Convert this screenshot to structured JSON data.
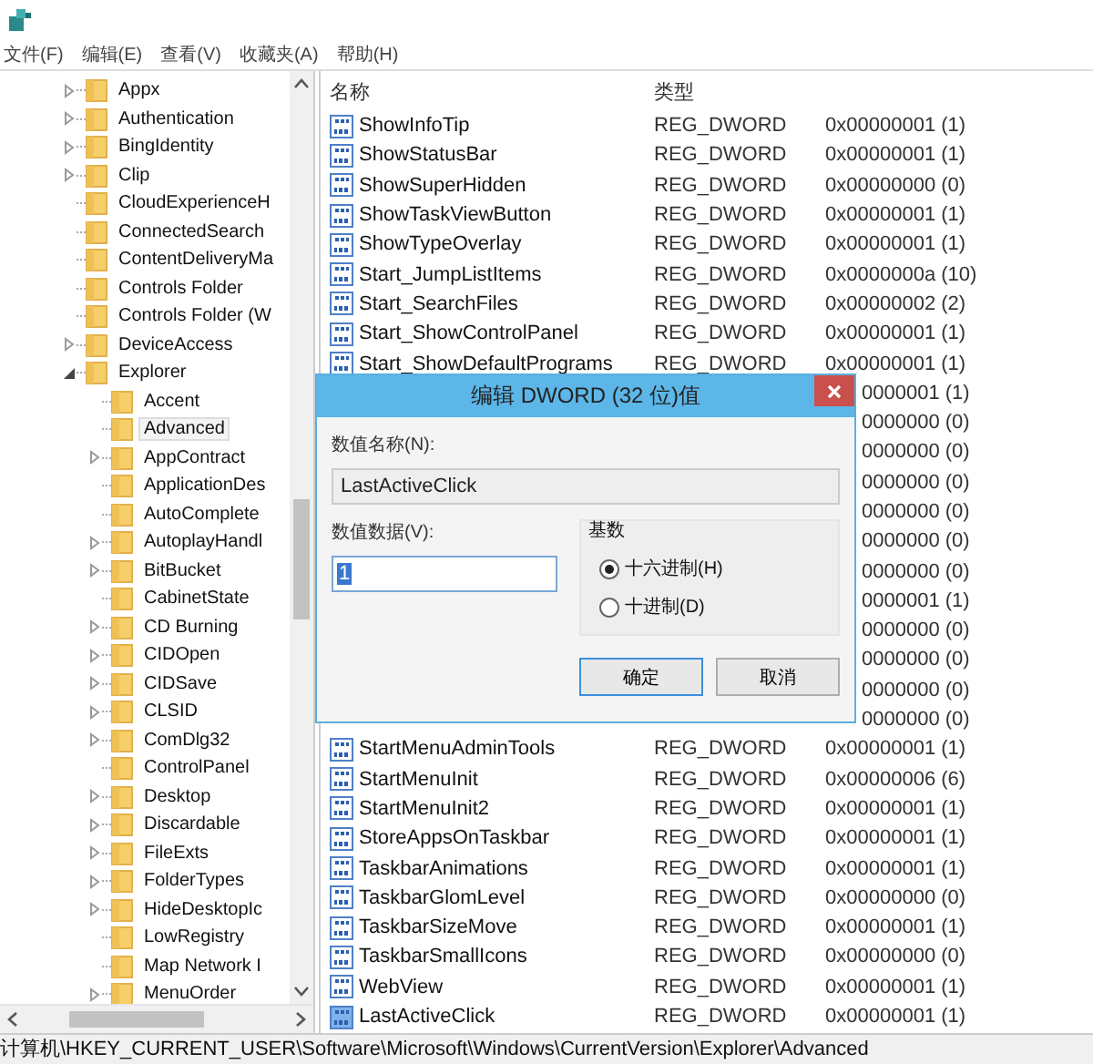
{
  "menu": [
    {
      "label": "文件(F)"
    },
    {
      "label": "编辑(E)"
    },
    {
      "label": "查看(V)"
    },
    {
      "label": "收藏夹(A)"
    },
    {
      "label": "帮助(H)"
    }
  ],
  "tree": {
    "items": [
      {
        "label": "Appx",
        "expanded": false,
        "selected": false
      },
      {
        "label": "Authentication",
        "expanded": false,
        "selected": false
      },
      {
        "label": "BingIdentity",
        "expanded": false,
        "selected": false
      },
      {
        "label": "Clip",
        "expanded": false,
        "selected": false
      },
      {
        "label": "CloudExperienceH",
        "selected": false
      },
      {
        "label": "ConnectedSearch",
        "selected": false
      },
      {
        "label": "ContentDeliveryMa",
        "selected": false
      },
      {
        "label": "Controls Folder",
        "selected": false
      },
      {
        "label": "Controls Folder (W",
        "selected": false
      },
      {
        "label": "DeviceAccess",
        "expanded": false,
        "selected": false
      },
      {
        "label": "Explorer",
        "expanded": true,
        "selected": false,
        "children": [
          {
            "label": "Accent",
            "selected": false
          },
          {
            "label": "Advanced",
            "selected": true
          },
          {
            "label": "AppContract",
            "expanded": false,
            "selected": false
          },
          {
            "label": "ApplicationDes",
            "selected": false
          },
          {
            "label": "AutoComplete",
            "selected": false
          },
          {
            "label": "AutoplayHandl",
            "expanded": false,
            "selected": false
          },
          {
            "label": "BitBucket",
            "expanded": false,
            "selected": false
          },
          {
            "label": "CabinetState",
            "selected": false
          },
          {
            "label": "CD Burning",
            "expanded": false,
            "selected": false
          },
          {
            "label": "CIDOpen",
            "expanded": false,
            "selected": false
          },
          {
            "label": "CIDSave",
            "expanded": false,
            "selected": false
          },
          {
            "label": "CLSID",
            "expanded": false,
            "selected": false
          },
          {
            "label": "ComDlg32",
            "expanded": false,
            "selected": false
          },
          {
            "label": "ControlPanel",
            "selected": false
          },
          {
            "label": "Desktop",
            "expanded": false,
            "selected": false
          },
          {
            "label": "Discardable",
            "expanded": false,
            "selected": false
          },
          {
            "label": "FileExts",
            "expanded": false,
            "selected": false
          },
          {
            "label": "FolderTypes",
            "expanded": false,
            "selected": false
          },
          {
            "label": "HideDesktopIc",
            "expanded": false,
            "selected": false
          },
          {
            "label": "LowRegistry",
            "selected": false
          },
          {
            "label": "Map Network I",
            "selected": false
          },
          {
            "label": "MenuOrder",
            "expanded": false,
            "selected": false
          }
        ]
      }
    ]
  },
  "values": {
    "columns": [
      "名称",
      "类型"
    ],
    "rows": [
      {
        "kind": "entry",
        "name": "ShowInfoTip",
        "type": "REG_DWORD",
        "data": "0x00000001 (1)",
        "selected": false
      },
      {
        "kind": "entry",
        "name": "ShowStatusBar",
        "type": "REG_DWORD",
        "data": "0x00000001 (1)",
        "selected": false
      },
      {
        "kind": "entry",
        "name": "ShowSuperHidden",
        "type": "REG_DWORD",
        "data": "0x00000000 (0)",
        "selected": false
      },
      {
        "kind": "entry",
        "name": "ShowTaskViewButton",
        "type": "REG_DWORD",
        "data": "0x00000001 (1)",
        "selected": false
      },
      {
        "kind": "entry",
        "name": "ShowTypeOverlay",
        "type": "REG_DWORD",
        "data": "0x00000001 (1)",
        "selected": false
      },
      {
        "kind": "entry",
        "name": "Start_JumpListItems",
        "type": "REG_DWORD",
        "data": "0x0000000a (10)",
        "selected": false
      },
      {
        "kind": "entry",
        "name": "Start_SearchFiles",
        "type": "REG_DWORD",
        "data": "0x00000002 (2)",
        "selected": false
      },
      {
        "kind": "entry",
        "name": "Start_ShowControlPanel",
        "type": "REG_DWORD",
        "data": "0x00000001 (1)",
        "selected": false
      },
      {
        "kind": "entry",
        "name": "Start_ShowDefaultPrograms",
        "type": "REG_DWORD",
        "data": "0x00000001 (1)",
        "selected": false
      },
      {
        "kind": "covered",
        "data": "0000001 (1)"
      },
      {
        "kind": "covered",
        "data": "0000000 (0)"
      },
      {
        "kind": "covered",
        "data": "0000000 (0)"
      },
      {
        "kind": "covered",
        "data": "0000000 (0)"
      },
      {
        "kind": "covered",
        "data": "0000000 (0)"
      },
      {
        "kind": "covered",
        "data": "0000000 (0)"
      },
      {
        "kind": "covered",
        "data": "0000000 (0)"
      },
      {
        "kind": "covered",
        "data": "0000001 (1)"
      },
      {
        "kind": "covered",
        "data": "0000000 (0)"
      },
      {
        "kind": "covered",
        "data": "0000000 (0)"
      },
      {
        "kind": "covered",
        "data": "0000000 (0)"
      },
      {
        "kind": "covered",
        "data": "0000000 (0)"
      },
      {
        "kind": "entry",
        "name": "StartMenuAdminTools",
        "type": "REG_DWORD",
        "data": "0x00000001 (1)",
        "selected": false
      },
      {
        "kind": "entry",
        "name": "StartMenuInit",
        "type": "REG_DWORD",
        "data": "0x00000006 (6)",
        "selected": false
      },
      {
        "kind": "entry",
        "name": "StartMenuInit2",
        "type": "REG_DWORD",
        "data": "0x00000001 (1)",
        "selected": false
      },
      {
        "kind": "entry",
        "name": "StoreAppsOnTaskbar",
        "type": "REG_DWORD",
        "data": "0x00000001 (1)",
        "selected": false
      },
      {
        "kind": "entry",
        "name": "TaskbarAnimations",
        "type": "REG_DWORD",
        "data": "0x00000001 (1)",
        "selected": false
      },
      {
        "kind": "entry",
        "name": "TaskbarGlomLevel",
        "type": "REG_DWORD",
        "data": "0x00000000 (0)",
        "selected": false
      },
      {
        "kind": "entry",
        "name": "TaskbarSizeMove",
        "type": "REG_DWORD",
        "data": "0x00000001 (1)",
        "selected": false
      },
      {
        "kind": "entry",
        "name": "TaskbarSmallIcons",
        "type": "REG_DWORD",
        "data": "0x00000000 (0)",
        "selected": false
      },
      {
        "kind": "entry",
        "name": "WebView",
        "type": "REG_DWORD",
        "data": "0x00000001 (1)",
        "selected": false
      },
      {
        "kind": "entry",
        "name": "LastActiveClick",
        "type": "REG_DWORD",
        "data": "0x00000001 (1)",
        "selected": true
      }
    ]
  },
  "dialog": {
    "title": "编辑 DWORD (32 位)值",
    "name_label": "数值名称(N):",
    "name_value": "LastActiveClick",
    "data_label": "数值数据(V):",
    "data_value": "1",
    "base_label": "基数",
    "radios": [
      {
        "label": "十六进制(H)",
        "selected": true
      },
      {
        "label": "十进制(D)",
        "selected": false
      }
    ],
    "buttons": [
      {
        "label": "确定",
        "default": true
      },
      {
        "label": "取消",
        "default": false
      }
    ]
  },
  "status_bar": "计算机\\HKEY_CURRENT_USER\\Software\\Microsoft\\Windows\\CurrentVersion\\Explorer\\Advanced"
}
